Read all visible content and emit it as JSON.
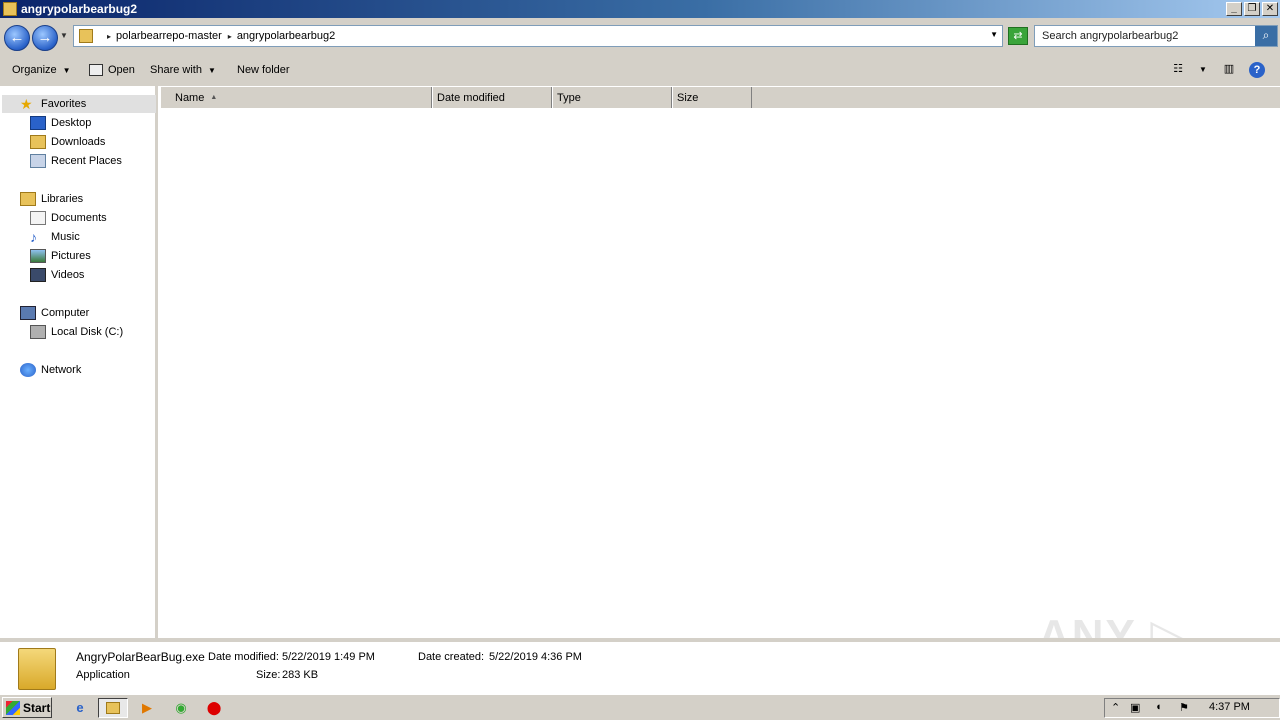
{
  "window": {
    "title": "angrypolarbearbug2"
  },
  "address": {
    "crumbs": [
      "polarbearrepo-master",
      "angrypolarbearbug2"
    ],
    "search_placeholder": "Search angrypolarbearbug2"
  },
  "toolbar": {
    "organize": "Organize",
    "open": "Open",
    "share_with": "Share with",
    "new_folder": "New folder"
  },
  "nav": {
    "favorites": "Favorites",
    "desktop": "Desktop",
    "downloads": "Downloads",
    "recent_places": "Recent Places",
    "libraries": "Libraries",
    "documents": "Documents",
    "music": "Music",
    "pictures": "Pictures",
    "videos": "Videos",
    "computer": "Computer",
    "local_disk": "Local Disk (C:)",
    "network": "Network"
  },
  "columns": {
    "name": "Name",
    "date_modified": "Date modified",
    "type": "Type",
    "size": "Size"
  },
  "details": {
    "filename": "AngryPolarBearBug.exe",
    "filetype": "Application",
    "date_modified_label": "Date modified:",
    "date_modified": "5/22/2019 1:49 PM",
    "date_created_label": "Date created:",
    "date_created": "5/22/2019 4:36 PM",
    "size_label": "Size:",
    "size": "283 KB"
  },
  "taskbar": {
    "start": "Start",
    "clock": "4:37 PM"
  },
  "watermark": "ANY ▷ RUN"
}
